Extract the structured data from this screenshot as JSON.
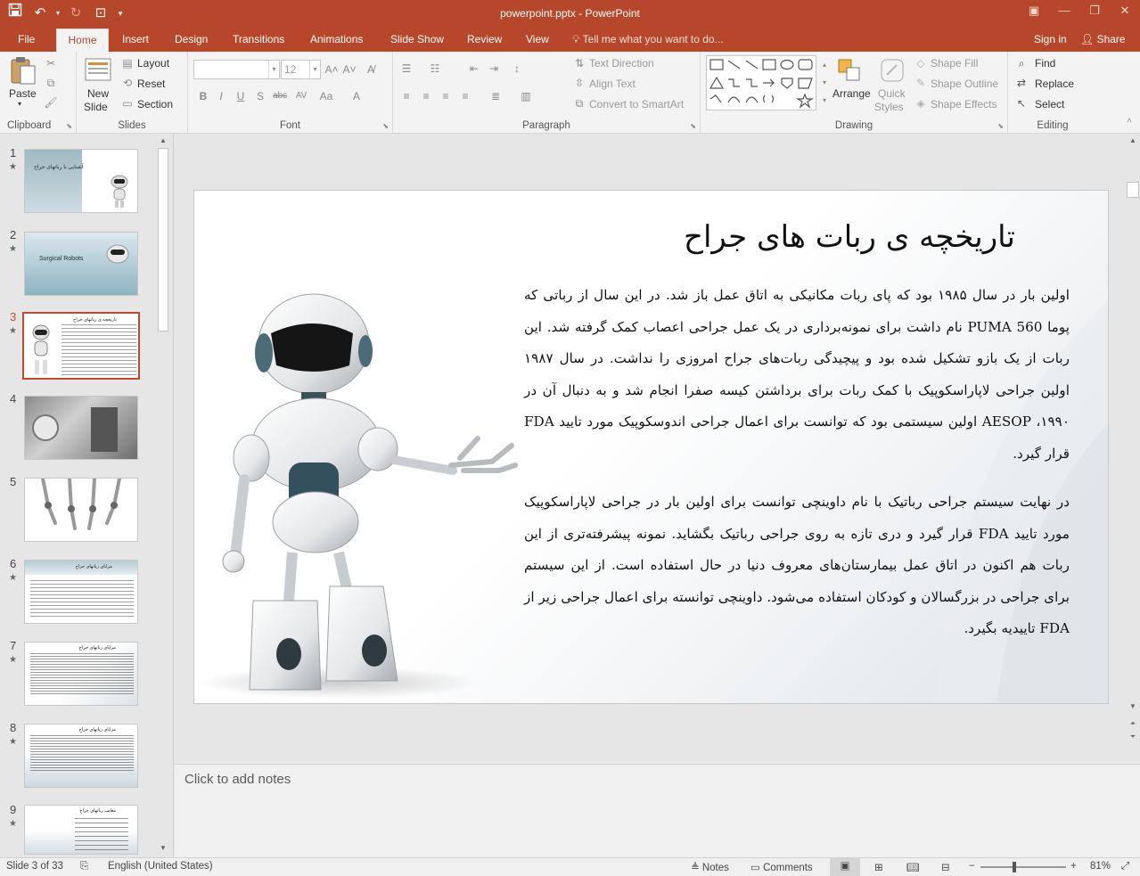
{
  "window": {
    "title": "powerpoint.pptx - PowerPoint"
  },
  "tabs": {
    "file": "File",
    "home": "Home",
    "insert": "Insert",
    "design": "Design",
    "transitions": "Transitions",
    "animations": "Animations",
    "slideshow": "Slide Show",
    "review": "Review",
    "view": "View",
    "tellme": "Tell me what you want to do...",
    "signin": "Sign in",
    "share": "Share"
  },
  "ribbon": {
    "clipboard": {
      "label": "Clipboard",
      "paste": "Paste"
    },
    "slides": {
      "label": "Slides",
      "new_slide_1": "New",
      "new_slide_2": "Slide",
      "layout": "Layout",
      "reset": "Reset",
      "section": "Section"
    },
    "font": {
      "label": "Font",
      "font_name": "",
      "font_size": "12"
    },
    "paragraph": {
      "label": "Paragraph",
      "text_direction": "Text Direction",
      "align_text": "Align Text",
      "convert_smartart": "Convert to SmartArt"
    },
    "drawing": {
      "label": "Drawing",
      "arrange": "Arrange",
      "quick_styles_1": "Quick",
      "quick_styles_2": "Styles",
      "shape_fill": "Shape Fill",
      "shape_outline": "Shape Outline",
      "shape_effects": "Shape Effects"
    },
    "editing": {
      "label": "Editing",
      "find": "Find",
      "replace": "Replace",
      "select": "Select"
    }
  },
  "thumbnails": [
    {
      "num": "1",
      "star": "★",
      "caption": "آشنایی با رباتهای جراح"
    },
    {
      "num": "2",
      "star": "★",
      "caption": "Surgical Robots"
    },
    {
      "num": "3",
      "star": "★",
      "caption": "تاریخچه ی رباتهای جراح"
    },
    {
      "num": "4",
      "star": "",
      "caption": ""
    },
    {
      "num": "5",
      "star": "",
      "caption": ""
    },
    {
      "num": "6",
      "star": "★",
      "caption": "مزایای رباتهای جراح"
    },
    {
      "num": "7",
      "star": "★",
      "caption": "مزایای رباتهای جراح"
    },
    {
      "num": "8",
      "star": "★",
      "caption": "مزایای رباتهای جراح"
    },
    {
      "num": "9",
      "star": "★",
      "caption": "معایب رباتهای جراح"
    }
  ],
  "slide": {
    "title": "تاریخچه ی ربات های جراح",
    "paragraph1": "اولین بار در سال ۱۹۸۵ بود که پای ربات مکانیکی به اتاق عمل باز شد. در این سال از رباتی که پوما  PUMA 560 نام داشت برای نمونه‌برداری در یک عمل جراحی اعصاب کمک گرفته شد. این ربات از یک بازو تشکیل شده بود و پیچیدگی ربات‌های جراح امروزی را نداشت. در سال ۱۹۸۷ اولین جراحی لاپاراسکوپیک با کمک ربات برای برداشتن کیسه صفرا انجام شد و به دنبال آن در ۱۹۹۰، AESOP اولین سیستمی بود که توانست برای اعمال جراحی اندوسکوپیک مورد تایید  FDA قرار گیرد.",
    "paragraph2": "در نهایت سیستم جراحی رباتیک با نام داوینچی توانست برای اولین بار در جراحی لاپاراسکوپیک مورد تایید  FDA قرار گیرد و دری تازه به روی جراحی رباتیک بگشاید. نمونه پیشرفته‌تری از این ربات هم اکنون در اتاق عمل بیمارستان‌های معروف دنیا در حال استفاده است. از این سیستم برای جراحی در بزرگسالان و کودکان استفاده می‌شود. داوینچی توانسته برای اعمال جراحی زیر از  FDA تاییدیه بگیرد."
  },
  "notes": {
    "placeholder": "Click to add notes"
  },
  "status": {
    "slide_of": "Slide 3 of 33",
    "language": "English (United States)",
    "notes": "Notes",
    "comments": "Comments",
    "zoom": "81%"
  },
  "colors": {
    "accent": "#b7472a",
    "selection": "#c5482c"
  }
}
